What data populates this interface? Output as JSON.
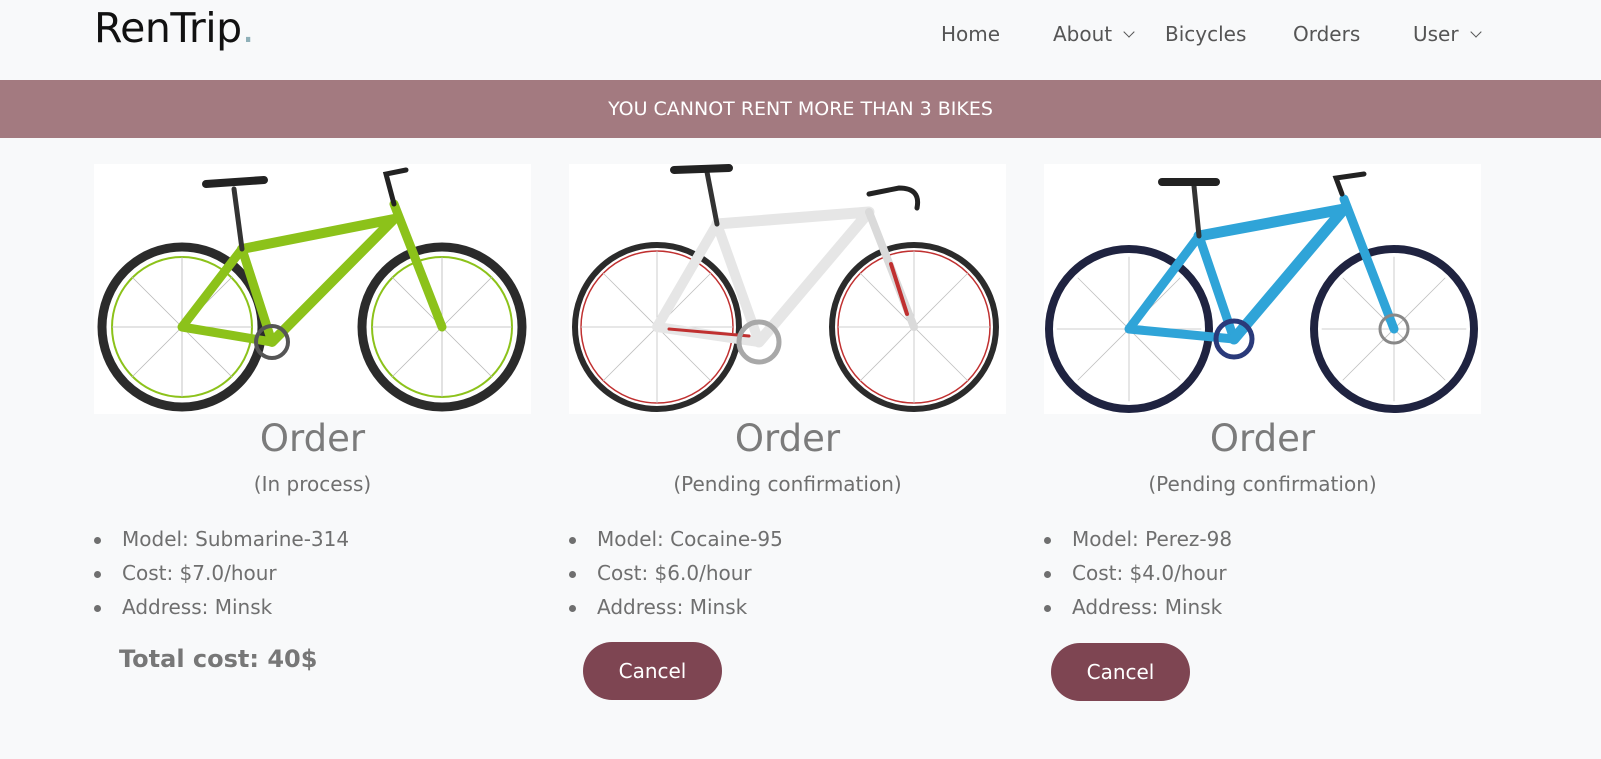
{
  "brand": {
    "name": "RenTrip",
    "dot": "."
  },
  "nav": {
    "home": "Home",
    "about": "About",
    "bicycles": "Bicycles",
    "orders": "Orders",
    "user": "User"
  },
  "banner": "YOU CANNOT RENT MORE THAN 3 BIKES",
  "orders": [
    {
      "title": "Order",
      "status": "(In process)",
      "model": "Model: Submarine-314",
      "cost": "Cost: $7.0/hour",
      "address": "Address: Minsk",
      "bike_color": "#8cc21a"
    },
    {
      "title": "Order",
      "status": "(Pending confirmation)",
      "model": "Model: Cocaine-95",
      "cost": "Cost: $6.0/hour",
      "address": "Address: Minsk",
      "cancel_label": "Cancel",
      "bike_color": "#e9e9e9"
    },
    {
      "title": "Order",
      "status": "(Pending confirmation)",
      "model": "Model: Perez-98",
      "cost": "Cost: $4.0/hour",
      "address": "Address: Minsk",
      "cancel_label": "Cancel",
      "bike_color": "#2fa4d8"
    }
  ],
  "total": "Total cost: 40$",
  "colors": {
    "banner": "#a37a80",
    "button": "#7e4552",
    "background": "#f8f9fa"
  }
}
